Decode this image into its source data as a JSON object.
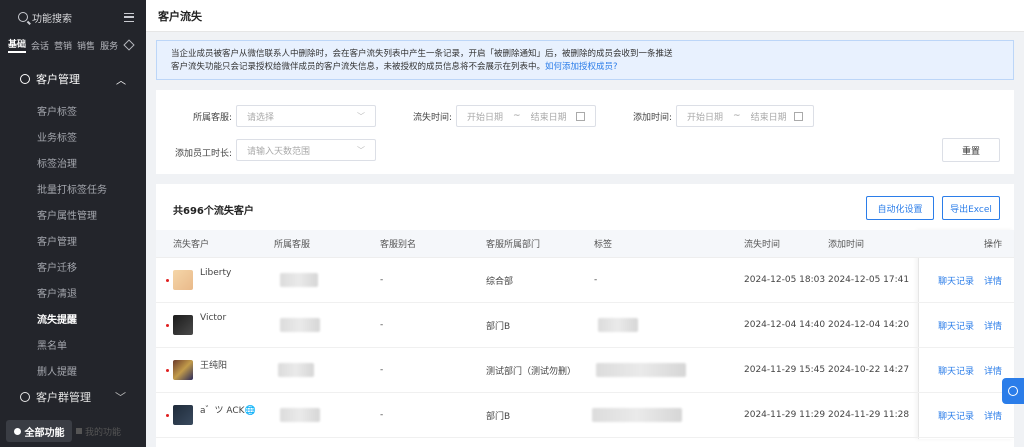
{
  "sidebar": {
    "search": "功能搜索",
    "topnav": [
      "基础",
      "会话",
      "营销",
      "销售",
      "服务"
    ],
    "group1": "客户管理",
    "items": [
      "客户标签",
      "业务标签",
      "标签治理",
      "批量打标签任务",
      "客户属性管理",
      "客户管理",
      "客户迁移",
      "客户清退",
      "流失提醒",
      "黑名单",
      "删人提醒"
    ],
    "group2": "客户群管理",
    "all_functions": "全部功能",
    "my_functions": "我的功能"
  },
  "header": {
    "title": "客户流失"
  },
  "notice": {
    "line1": "当企业成员被客户从微信联系人中删除时，会在客户流失列表中产生一条记录，开启「被删除通知」后，被删除的成员会收到一条推送",
    "line2": "客户流失功能只会记录授权给微伴成员的客户流失信息，未被授权的成员信息将不会展示在列表中。",
    "link": "如何添加授权成员?"
  },
  "filters": {
    "owner_label": "所属客服:",
    "owner_placeholder": "请选择",
    "lost_label": "流失时间:",
    "add_label": "添加时间:",
    "start_placeholder": "开始日期",
    "end_placeholder": "结束日期",
    "tilde": "~",
    "tenure_label": "添加员工时长:",
    "tenure_placeholder": "请输入天数范围",
    "reset": "重置"
  },
  "list": {
    "title": "共696个流失客户",
    "auto_button": "自动化设置",
    "export_button": "导出Excel",
    "columns": [
      "流失客户",
      "所属客服",
      "客服别名",
      "客服所属部门",
      "标签",
      "流失时间",
      "添加时间",
      "操作"
    ],
    "rows": [
      {
        "name": "Liberty",
        "alias": "-",
        "dept": "综合部",
        "tag": "-",
        "lost": "2024-12-05 18:03",
        "added": "2024-12-05 17:41",
        "chat": "聊天记录",
        "detail": "详情"
      },
      {
        "name": "Victor",
        "alias": "-",
        "dept": "部门B",
        "tag": "",
        "lost": "2024-12-04 14:40",
        "added": "2024-12-04 14:20",
        "chat": "聊天记录",
        "detail": "详情"
      },
      {
        "name": "王纯阳",
        "alias": "-",
        "dept": "测试部门（测试勿删）",
        "tag": "",
        "lost": "2024-11-29 15:45",
        "added": "2024-10-22 14:27",
        "chat": "聊天记录",
        "detail": "详情"
      },
      {
        "name": "a゛ツ ACK🌐",
        "alias": "-",
        "dept": "部门B",
        "tag": "",
        "lost": "2024-11-29 11:29",
        "added": "2024-11-29 11:28",
        "chat": "聊天记录",
        "detail": "详情"
      }
    ]
  }
}
